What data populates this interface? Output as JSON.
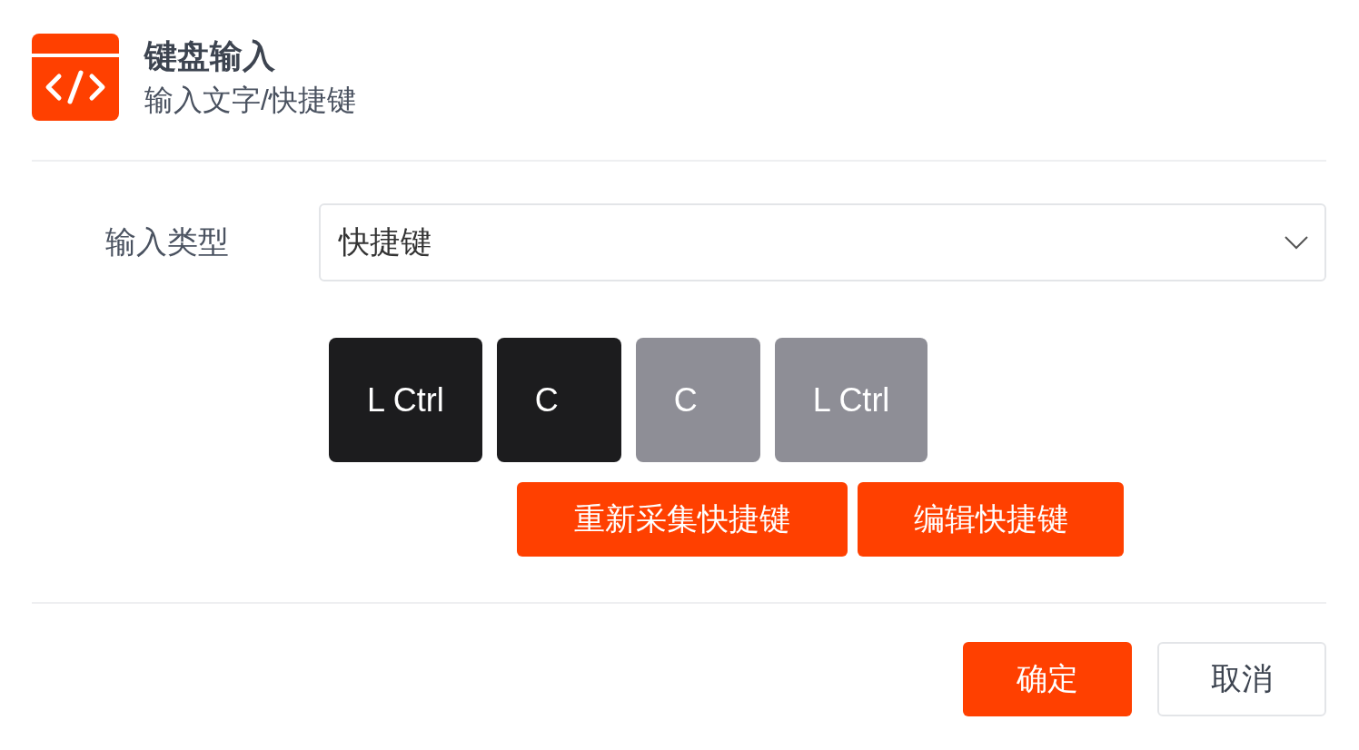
{
  "header": {
    "title": "键盘输入",
    "subtitle": "输入文字/快捷键"
  },
  "form": {
    "label": "输入类型",
    "select_value": "快捷键"
  },
  "keys": [
    {
      "label": "L Ctrl",
      "pressed": true
    },
    {
      "label": "C",
      "pressed": true
    },
    {
      "label": "C",
      "pressed": false
    },
    {
      "label": "L Ctrl",
      "pressed": false
    }
  ],
  "actions": [
    "重新采集快捷键",
    "编辑快捷键"
  ],
  "footer": {
    "confirm": "确定",
    "cancel": "取消"
  }
}
